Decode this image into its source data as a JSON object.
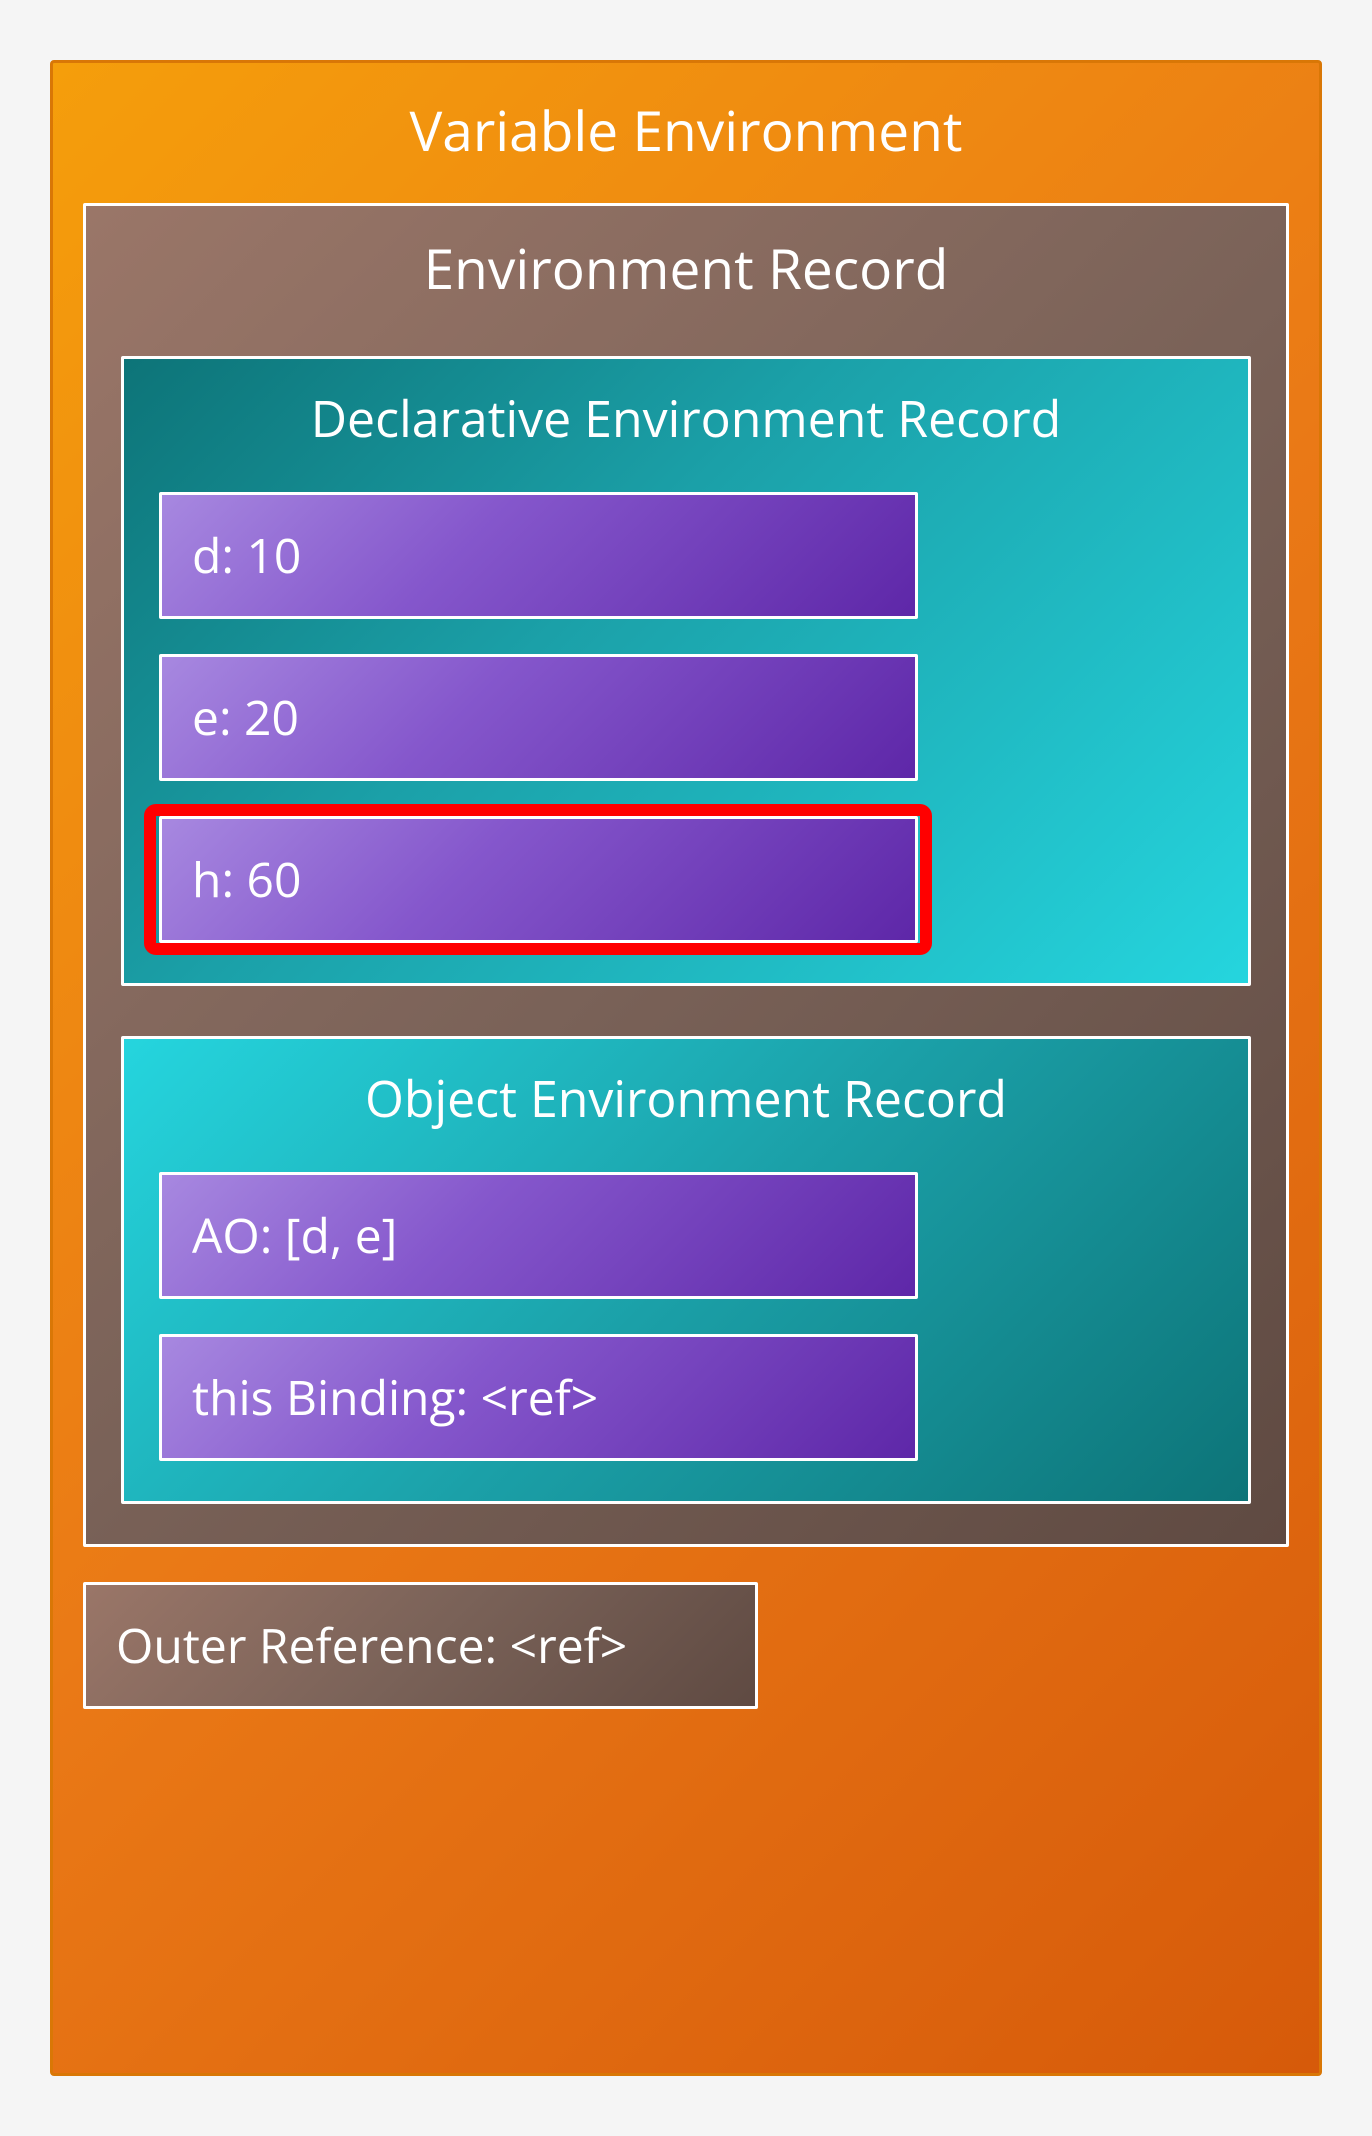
{
  "variableEnvironment": {
    "title": "Variable Environment",
    "environmentRecord": {
      "title": "Environment Record",
      "declarativeRecord": {
        "title": "Declarative Environment Record",
        "bindings": [
          {
            "key": "d",
            "value": "10",
            "display": "d: 10",
            "highlighted": false
          },
          {
            "key": "e",
            "value": "20",
            "display": "e: 20",
            "highlighted": false
          },
          {
            "key": "h",
            "value": "60",
            "display": "h: 60",
            "highlighted": true
          }
        ]
      },
      "objectRecord": {
        "title": "Object Environment Record",
        "bindings": [
          {
            "display": "AO: [d, e]"
          },
          {
            "display": "this Binding: <ref>"
          }
        ]
      }
    },
    "outerReference": {
      "display": "Outer Reference: <ref>"
    }
  },
  "colors": {
    "orange_gradient_start": "#f59e0b",
    "orange_gradient_end": "#d65a0a",
    "brown_gradient_start": "#9a7668",
    "brown_gradient_end": "#5f4a42",
    "teal_gradient_start": "#0d7478",
    "teal_gradient_end": "#25d5de",
    "purple_gradient_start": "#a788e0",
    "purple_gradient_end": "#5e27a8",
    "highlight_red": "#ff0000",
    "border_white": "#ffffff"
  }
}
